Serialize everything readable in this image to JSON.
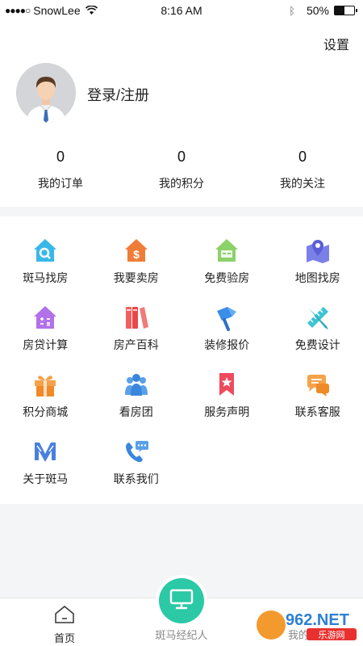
{
  "status_bar": {
    "carrier": "SnowLee",
    "time": "8:16 AM",
    "battery": "50%",
    "battery_level": 0.5
  },
  "profile": {
    "settings_label": "设置",
    "login_label": "登录/注册",
    "stats": [
      {
        "value": "0",
        "label": "我的订单"
      },
      {
        "value": "0",
        "label": "我的积分"
      },
      {
        "value": "0",
        "label": "我的关注"
      }
    ]
  },
  "services": [
    {
      "label": "斑马找房",
      "icon": "house-search-icon"
    },
    {
      "label": "我要卖房",
      "icon": "house-dollar-icon"
    },
    {
      "label": "免费验房",
      "icon": "house-inspect-icon"
    },
    {
      "label": "地图找房",
      "icon": "map-pin-icon"
    },
    {
      "label": "房贷计算",
      "icon": "calculator-house-icon"
    },
    {
      "label": "房产百科",
      "icon": "books-icon"
    },
    {
      "label": "装修报价",
      "icon": "paint-roller-icon"
    },
    {
      "label": "免费设计",
      "icon": "pencil-ruler-icon"
    },
    {
      "label": "积分商城",
      "icon": "gift-icon"
    },
    {
      "label": "看房团",
      "icon": "group-icon"
    },
    {
      "label": "服务声明",
      "icon": "bookmark-star-icon"
    },
    {
      "label": "联系客服",
      "icon": "chat-bubbles-icon"
    },
    {
      "label": "关于斑马",
      "icon": "zebra-logo-icon"
    },
    {
      "label": "联系我们",
      "icon": "phone-chat-icon"
    }
  ],
  "tabbar": {
    "home_label": "首页",
    "center_label": "斑马经纪人",
    "mine_label": "我的"
  },
  "watermark": {
    "text": "962.NET",
    "subtext": "乐游网"
  }
}
